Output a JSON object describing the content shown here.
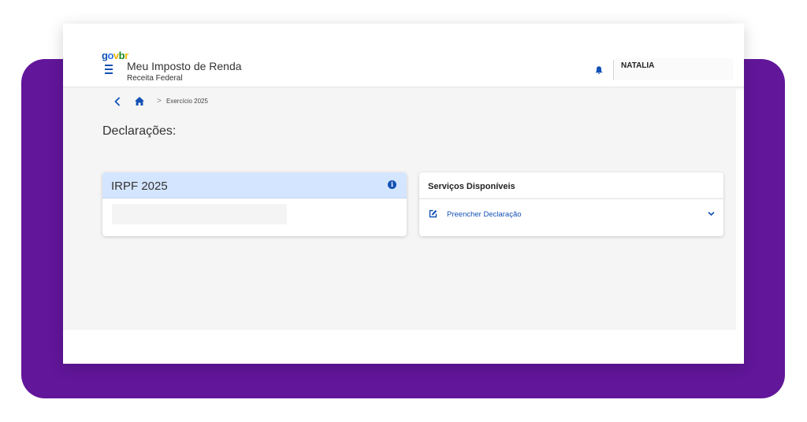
{
  "header": {
    "logo": {
      "g": "g",
      "o": "o",
      "v": "v",
      "b": "b",
      "r": "r"
    },
    "app_title": "Meu Imposto de Renda",
    "app_subtitle": "Receita Federal",
    "user_name": "NATALIA",
    "icons": {
      "menu": "menu-icon",
      "bell": "bell-icon"
    }
  },
  "breadcrumb": {
    "separator": ">",
    "current": "Exercício 2025",
    "icons": {
      "back": "chevron-left-icon",
      "home": "home-icon"
    }
  },
  "main": {
    "section_title": "Declarações:",
    "declaration_card": {
      "title": "IRPF 2025",
      "info_glyph": "i"
    },
    "services_card": {
      "title": "Serviços Disponíveis",
      "items": [
        {
          "label": "Preencher Declaração",
          "icon": "edit-icon",
          "expand_icon": "chevron-down-icon"
        }
      ]
    }
  },
  "colors": {
    "brand_blue": "#1351b4",
    "card_header_blue": "#d4e5ff",
    "background_purple": "#62169a",
    "content_bg": "#f5f5f5"
  }
}
